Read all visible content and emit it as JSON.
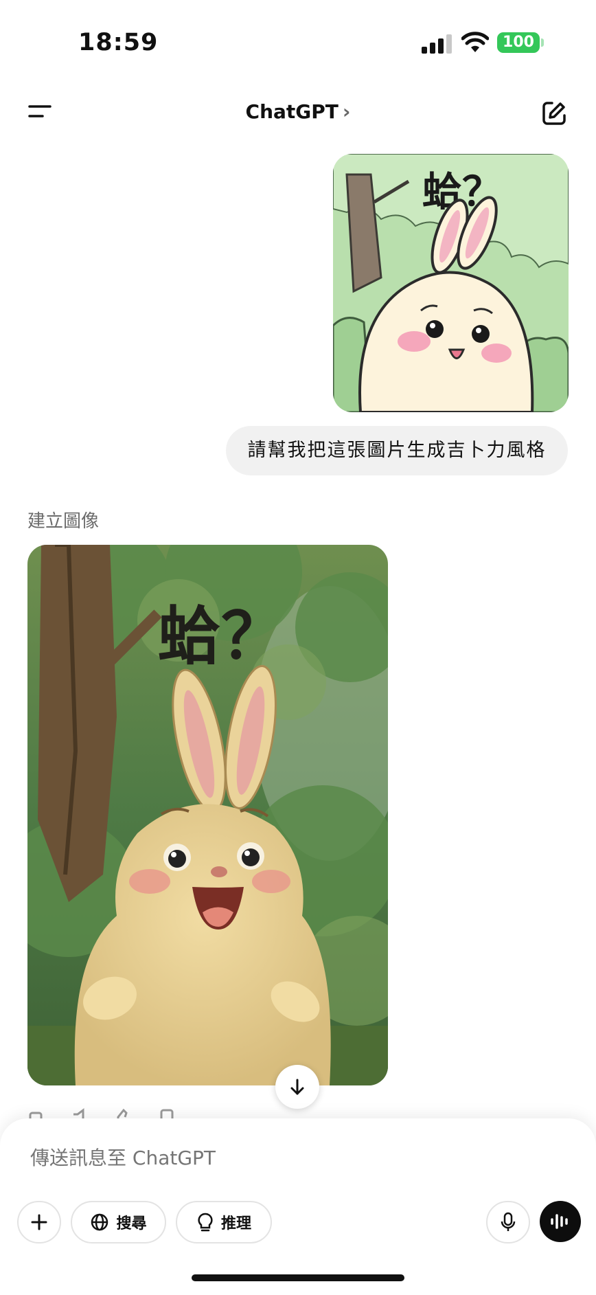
{
  "status_bar": {
    "time": "18:59",
    "battery": "100"
  },
  "header": {
    "title": "ChatGPT",
    "title_chevron": "›"
  },
  "user_image": {
    "text": "蛤？"
  },
  "user_message": "請幫我把這張圖片生成吉卜力風格",
  "assistant": {
    "section_label": "建立圖像",
    "image_text": "蛤？"
  },
  "composer": {
    "placeholder": "傳送訊息至 ChatGPT",
    "search_label": "搜尋",
    "reason_label": "推理"
  },
  "icons": {
    "menu": "menu-icon",
    "compose": "compose-icon",
    "scroll_down": "arrow-down-icon",
    "plus": "plus-icon",
    "globe": "globe-icon",
    "bulb": "lightbulb-icon",
    "mic": "mic-icon",
    "voice": "voice-wave-icon"
  },
  "colors": {
    "battery": "#34c759",
    "bubble": "#f1f1f1",
    "voice_button": "#0d0d0d"
  }
}
